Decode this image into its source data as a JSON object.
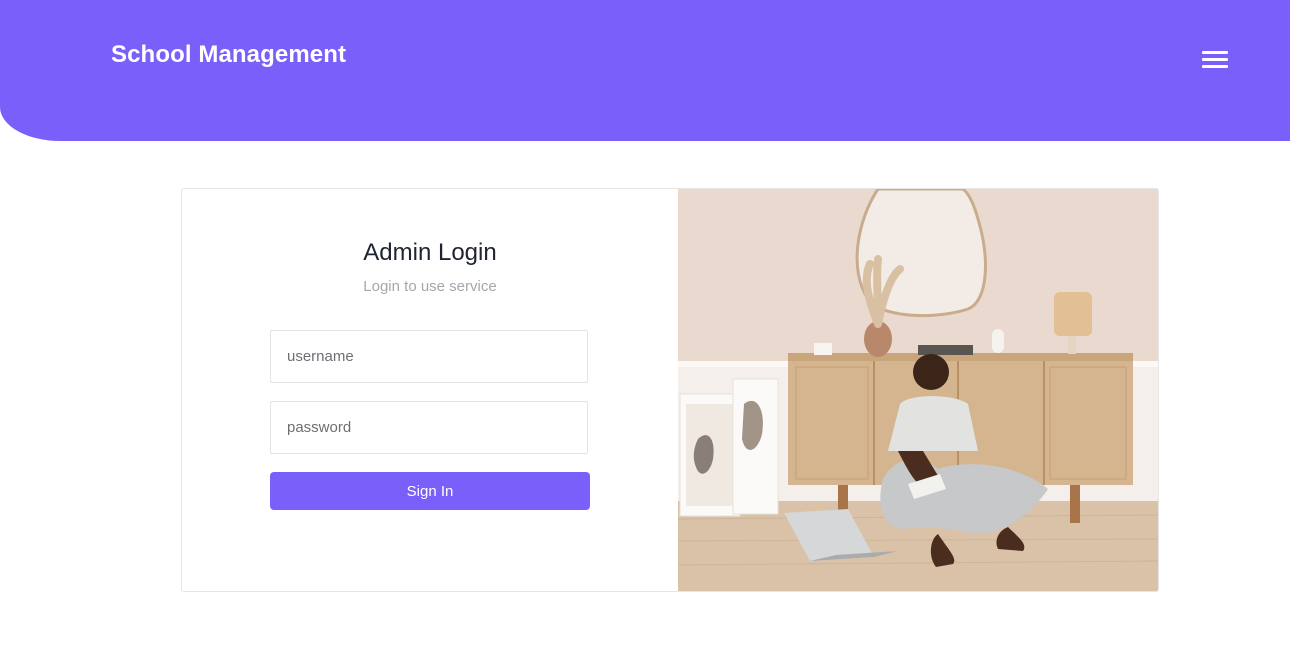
{
  "header": {
    "brand": "School Management",
    "menu_icon": "hamburger-menu-icon",
    "background_color": "#7b5ffb"
  },
  "login": {
    "title": "Admin Login",
    "subtitle": "Login to use service",
    "username_placeholder": "username",
    "password_placeholder": "password",
    "signin_label": "Sign In"
  },
  "photo": {
    "description_icon": "person-studying-photo"
  }
}
